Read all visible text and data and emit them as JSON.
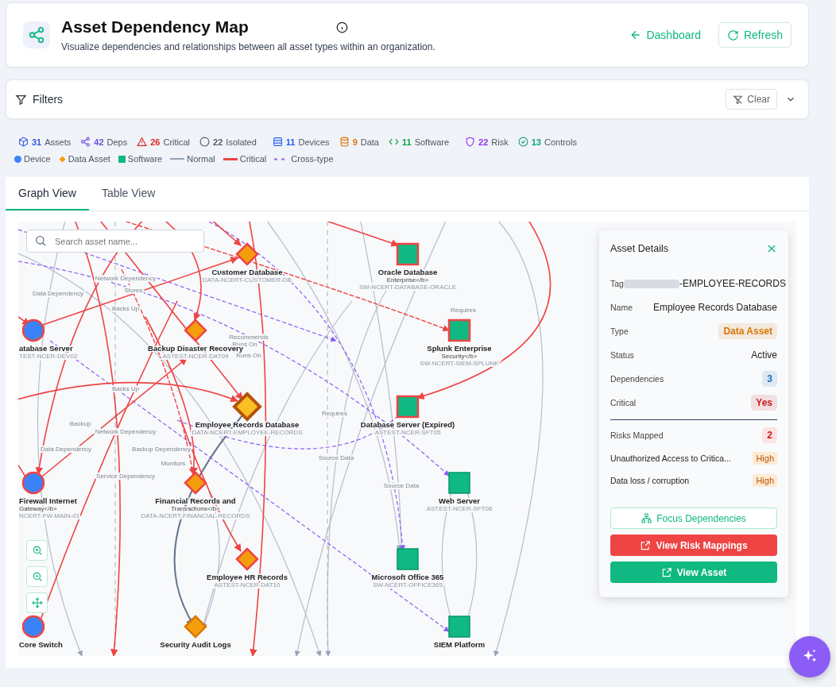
{
  "header": {
    "title": "Asset Dependency Map",
    "subtitle": "Visualize dependencies and relationships between all asset types within an organization.",
    "back_link": "Dashboard",
    "refresh_button": "Refresh"
  },
  "filters": {
    "title": "Filters",
    "clear_button": "Clear",
    "expanded": false
  },
  "stats": [
    {
      "kind": "cube",
      "count": "31",
      "label": "Assets",
      "color": "#3b5bdb"
    },
    {
      "kind": "share",
      "count": "42",
      "label": "Deps",
      "color": "#6d4fe0"
    },
    {
      "kind": "warning",
      "count": "26",
      "label": "Critical",
      "color": "#dc2626"
    },
    {
      "kind": "circle",
      "count": "22",
      "label": "Isolated",
      "color": "#555b66"
    },
    {
      "kind": "server",
      "count": "11",
      "label": "Devices",
      "color": "#2563eb"
    },
    {
      "kind": "database",
      "count": "9",
      "label": "Data",
      "color": "#d97706"
    },
    {
      "kind": "code",
      "count": "11",
      "label": "Software",
      "color": "#16a34a"
    },
    {
      "kind": "shield",
      "count": "22",
      "label": "Risk",
      "color": "#9333ea"
    },
    {
      "kind": "check",
      "count": "13",
      "label": "Controls",
      "color": "#0f9f7f"
    }
  ],
  "legend": [
    {
      "kind": "dot",
      "label": "Device",
      "color": "#3b82f6"
    },
    {
      "kind": "diamond",
      "label": "Data Asset",
      "color": "#f59e0b"
    },
    {
      "kind": "square",
      "label": "Software",
      "color": "#10b981"
    },
    {
      "kind": "line",
      "label": "Normal",
      "color": "#94a3b8"
    },
    {
      "kind": "line",
      "label": "Critical",
      "color": "#ef4444"
    },
    {
      "kind": "dashed",
      "label": "Cross-type",
      "color": "#8b5cf6"
    }
  ],
  "tabs": [
    {
      "label": "Graph View",
      "selected": true
    },
    {
      "label": "Table View",
      "selected": false
    }
  ],
  "graph": {
    "search": {
      "placeholder": "Search asset name..."
    },
    "nodes": [
      {
        "kind": "data",
        "critical": true,
        "selected": false,
        "name": "Customer Database",
        "tag": "DATA-NCERT-CUSTOMER-DB"
      },
      {
        "kind": "software",
        "critical": true,
        "selected": false,
        "name": "Oracle Database",
        "sub": "Enterprise</b>",
        "tag": "SW-NCERT-DATABASE-ORACLE"
      },
      {
        "kind": "device",
        "critical": true,
        "selected": false,
        "name": "atabase Server",
        "tag": "TEST-NCER-DEV02"
      },
      {
        "kind": "data",
        "critical": true,
        "selected": false,
        "name": "Backup Disaster Recovery",
        "tag": "ASTEST-NCER-DAT09"
      },
      {
        "kind": "software",
        "critical": true,
        "selected": false,
        "name": "Splunk Enterprise",
        "sub": "Security</b>",
        "tag": "SW-NCERT-SIEM-SPLUNK"
      },
      {
        "kind": "data",
        "critical": false,
        "selected": true,
        "name": "Employee Records Database",
        "tag": "DATA-NCERT-EMPLOYEE-RECORDS"
      },
      {
        "kind": "software",
        "critical": true,
        "selected": false,
        "name": "Database Server (Expired)",
        "tag": "ASTEST-NCER-SFT05"
      },
      {
        "kind": "device",
        "critical": true,
        "selected": false,
        "name": "Firewall Internet",
        "sub": "Gateway</b>",
        "tag": "NCERT-FW-MAIN-01"
      },
      {
        "kind": "data",
        "critical": true,
        "selected": false,
        "name": "Financial Records and",
        "sub": "Transactions</b>",
        "tag": "DATA-NCERT-FINANCIAL-RECORDS"
      },
      {
        "kind": "software",
        "critical": false,
        "selected": false,
        "name": "Web Server",
        "tag": "ASTEST-NCER-SFT06"
      },
      {
        "kind": "data",
        "critical": true,
        "selected": false,
        "name": "Employee HR Records",
        "tag": "ASTEST-NCER-DAT10"
      },
      {
        "kind": "software",
        "critical": false,
        "selected": false,
        "name": "Microsoft Office 365",
        "tag": "SW-NCERT-OFFICE365"
      },
      {
        "kind": "device",
        "critical": true,
        "selected": false,
        "name": "Core Switch"
      },
      {
        "kind": "data",
        "critical": false,
        "selected": false,
        "name": "Security Audit Logs"
      },
      {
        "kind": "software",
        "critical": false,
        "selected": false,
        "name": "SIEM Platform"
      }
    ],
    "edge_labels": [
      "Network Dependency",
      "Stores",
      "Data Dependency",
      "Backs Up",
      "Recommends",
      "Runs On",
      "Runs On",
      "Requires",
      "Backs Up",
      "Backup",
      "Network Dependency",
      "Requires",
      "Data Dependency",
      "Backup Dependency",
      "Monitors",
      "Service Dependency",
      "Source Data",
      "Source Data"
    ],
    "details": {
      "title": "Asset Details",
      "rows": [
        {
          "label": "Tag",
          "kind": "redacted",
          "value": "-EMPLOYEE-RECORDS"
        },
        {
          "label": "Name",
          "kind": "text",
          "value": "Employee Records Database"
        },
        {
          "label": "Type",
          "kind": "badge",
          "value": "Data Asset",
          "color": "#d97706"
        },
        {
          "label": "Status",
          "kind": "text",
          "value": "Active"
        },
        {
          "label": "Dependencies",
          "kind": "badge",
          "value": "3",
          "color": "#1d6fb8"
        },
        {
          "label": "Critical",
          "kind": "badge",
          "value": "Yes",
          "color": "#c81e1e"
        }
      ],
      "risks_label": "Risks Mapped",
      "risks_count": "2",
      "risks": [
        {
          "name": "Unauthorized Access to Critica...",
          "level": "High"
        },
        {
          "name": "Data loss / corruption",
          "level": "High"
        }
      ],
      "focus_button": "Focus Dependencies",
      "risk_button": "View Risk Mappings",
      "asset_button": "View Asset"
    }
  }
}
